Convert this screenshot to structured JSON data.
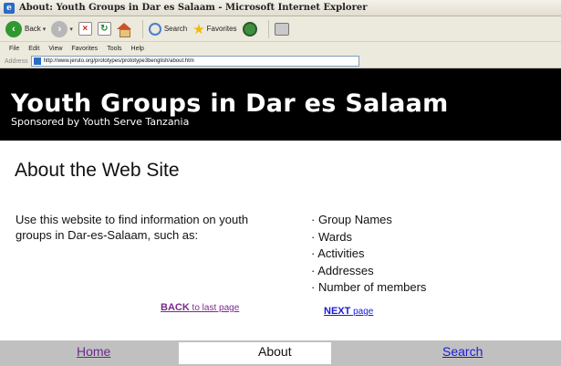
{
  "window": {
    "title": "About: Youth Groups in Dar es Salaam - Microsoft Internet Explorer"
  },
  "toolbar": {
    "back_label": "Back",
    "search_label": "Search",
    "favorites_label": "Favorites"
  },
  "menu": [
    "File",
    "Edit",
    "View",
    "Favorites",
    "Tools",
    "Help"
  ],
  "address": {
    "label": "Address",
    "url": "http://www.jeruto.org/prototypes/prototype3benglish/about.htm"
  },
  "header": {
    "title": "Youth Groups in Dar es Salaam",
    "subtitle": "Sponsored by Youth Serve Tanzania"
  },
  "main": {
    "heading": "About the Web Site",
    "intro": "Use this website to find information on youth groups in Dar-es-Salaam, such as:",
    "features": [
      "Group Names",
      "Wards",
      "Activities",
      "Addresses",
      "Number of members"
    ],
    "back_bold": "BACK",
    "back_rest": " to last page",
    "next_bold": "NEXT",
    "next_rest": " page"
  },
  "nav": {
    "home": "Home",
    "about": "About",
    "search": "Search"
  }
}
